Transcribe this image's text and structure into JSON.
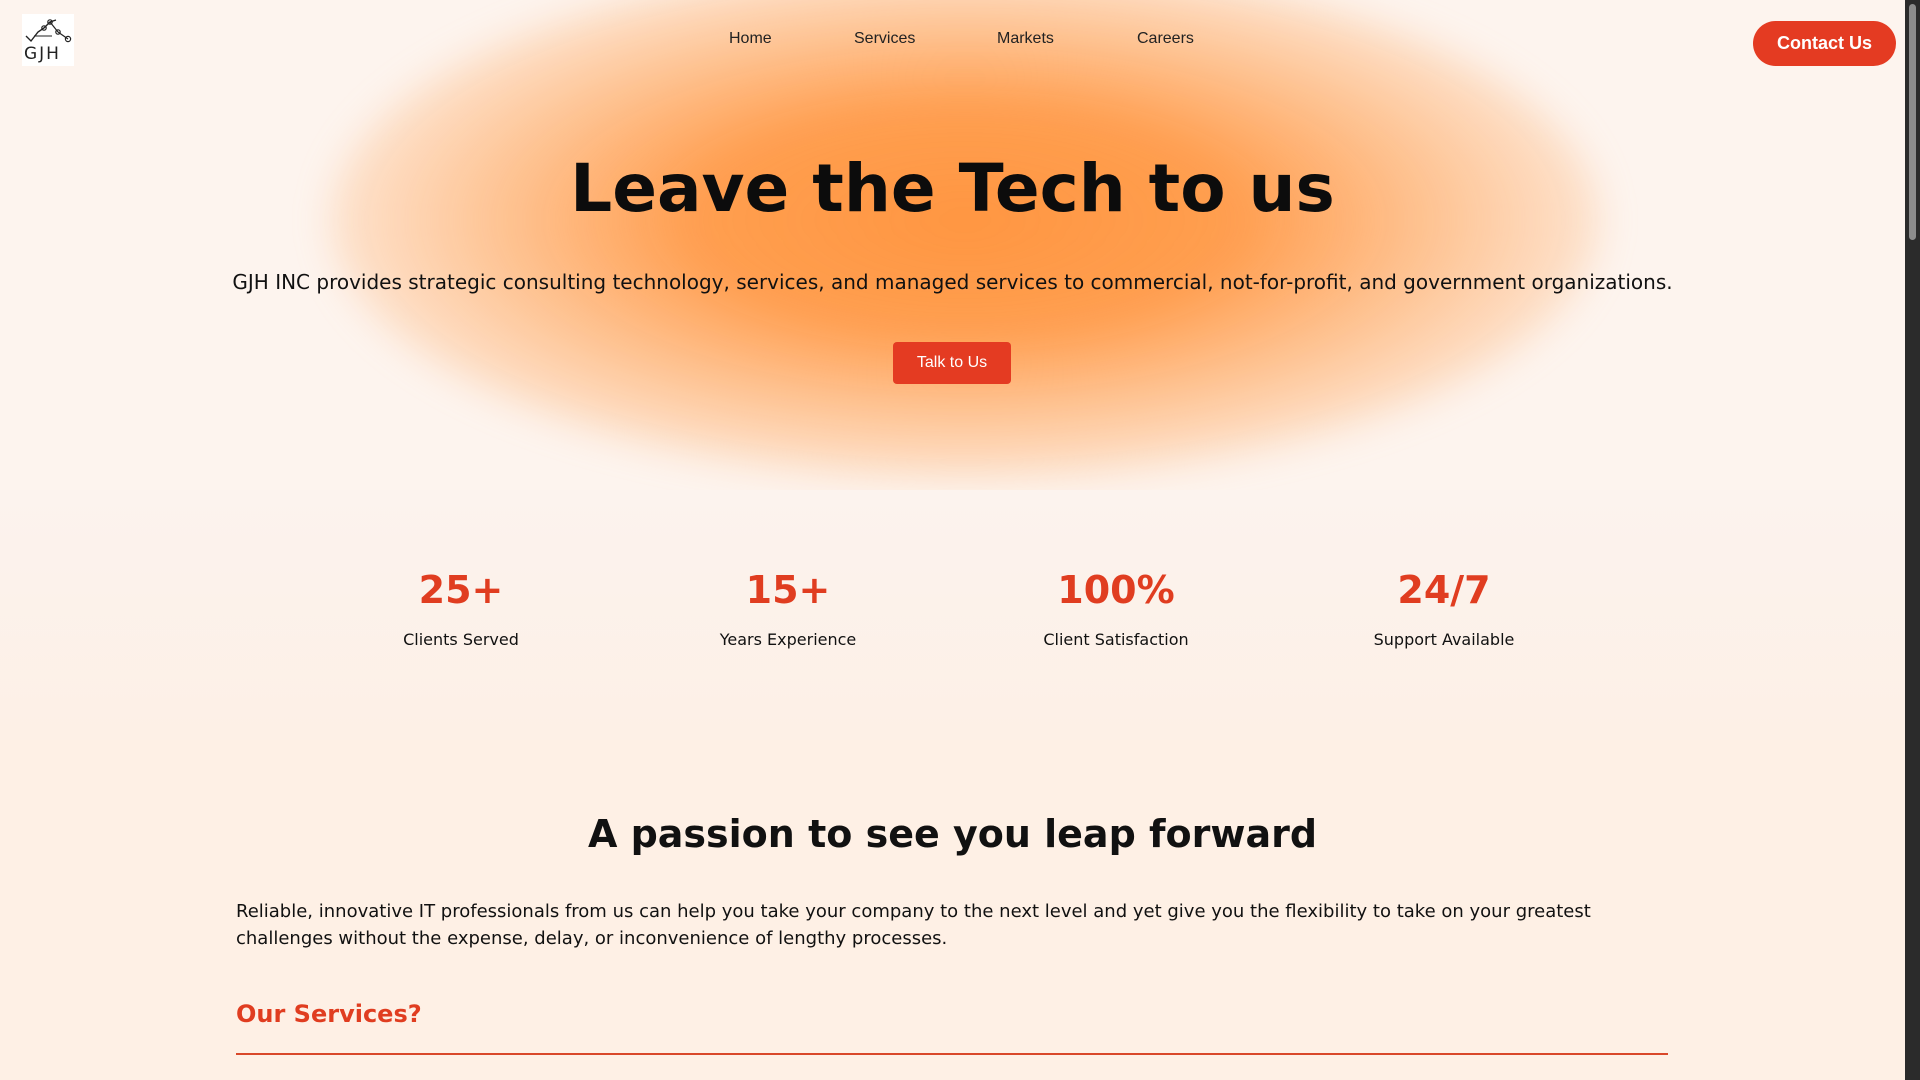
{
  "header": {
    "logo_text": "GJH",
    "nav": [
      {
        "label": "Home"
      },
      {
        "label": "Services"
      },
      {
        "label": "Markets"
      },
      {
        "label": "Careers"
      }
    ],
    "contact_label": "Contact Us"
  },
  "hero": {
    "title": "Leave the Tech to us",
    "subtitle": "GJH INC provides strategic consulting technology, services, and managed services to commercial, not-for-profit, and government organizations.",
    "cta_label": "Talk to Us"
  },
  "stats": [
    {
      "value": "25+",
      "label": "Clients Served"
    },
    {
      "value": "15+",
      "label": "Years Experience"
    },
    {
      "value": "100%",
      "label": "Client Satisfaction"
    },
    {
      "value": "24/7",
      "label": "Support Available"
    }
  ],
  "passion": {
    "title": "A passion to see you leap forward",
    "text": "Reliable, innovative IT professionals from us can help you take your company to the next level and yet give you the flexibility to take on your greatest challenges without the expense, delay, or inconvenience of lengthy processes.",
    "services_heading": "Our Services?"
  },
  "colors": {
    "accent": "#e43b22",
    "glow": "#ff9641",
    "background": "#fdf4ee"
  }
}
